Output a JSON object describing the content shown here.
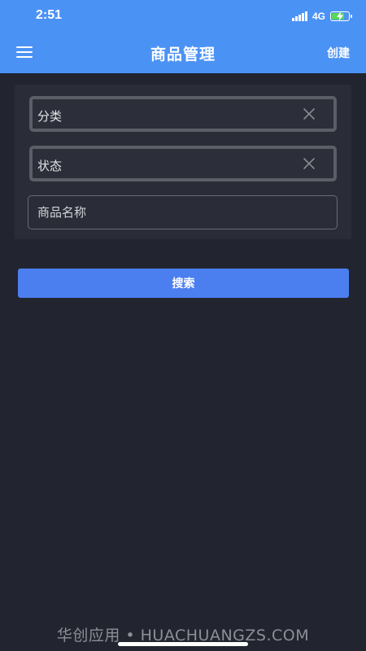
{
  "status_bar": {
    "time": "2:51",
    "network": "4G",
    "battery_level": 0.8,
    "battery_color": "#5ad65c"
  },
  "nav": {
    "title": "商品管理",
    "create_label": "创建",
    "menu_icon": "hamburger-menu-icon"
  },
  "filters": {
    "category_label": "分类",
    "status_label": "状态",
    "product_name_placeholder": "商品名称",
    "product_name_value": "",
    "clear_icon": "close-icon"
  },
  "actions": {
    "search_label": "搜索"
  },
  "watermark": {
    "text": "华创应用 • HUACHUANGZS.COM"
  },
  "colors": {
    "accent": "#4b92f5",
    "button": "#4b7ff0",
    "background": "#22242f"
  }
}
